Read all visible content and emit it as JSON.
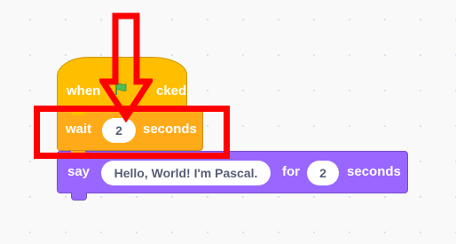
{
  "workspace": {
    "hat_block": {
      "label_left": "when",
      "label_right": "cked",
      "icon": "green-flag-icon"
    },
    "wait_block": {
      "label": "wait",
      "value": "2",
      "unit": "seconds"
    },
    "say_block": {
      "label": "say",
      "message": "Hello, World! I'm Pascal.",
      "for_label": "for",
      "duration": "2",
      "unit": "seconds"
    }
  },
  "colors": {
    "events": "#ffbf00",
    "control": "#ffab19",
    "looks": "#9966ff",
    "annotation": "#ff0000"
  },
  "annotations": {
    "arrow_icon": "red-down-arrow-icon",
    "highlight": "red-rectangle"
  }
}
